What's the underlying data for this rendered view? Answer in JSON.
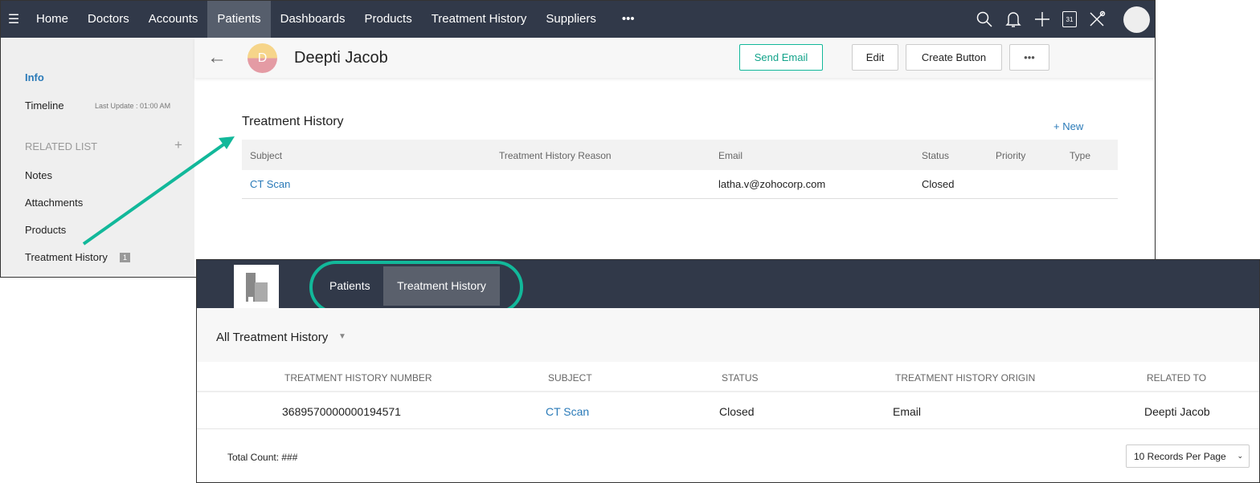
{
  "nav": {
    "items": [
      "Home",
      "Doctors",
      "Accounts",
      "Patients",
      "Dashboards",
      "Products",
      "Treatment History",
      "Suppliers"
    ],
    "active": "Patients",
    "more": "•••",
    "calendar_day": "31"
  },
  "sidebar": {
    "info": "Info",
    "timeline": "Timeline",
    "last_update": "Last Update : 01:00 AM",
    "related_list": "RELATED LIST",
    "add": "+",
    "items": [
      "Notes",
      "Attachments",
      "Products",
      "Treatment History"
    ],
    "treatment_count": "1"
  },
  "record": {
    "avatar_letter": "D",
    "name": "Deepti Jacob",
    "send_email": "Send Email",
    "edit": "Edit",
    "create_button": "Create Button",
    "more": "•••"
  },
  "related": {
    "title": "Treatment History",
    "new": "+ New",
    "headers": [
      "Subject",
      "Treatment History Reason",
      "Email",
      "Status",
      "Priority",
      "Type"
    ],
    "row": {
      "subject": "CT Scan",
      "reason": "",
      "email": "latha.v@zohocorp.com",
      "status": "Closed",
      "priority": "",
      "type": ""
    }
  },
  "portal": {
    "tabs": [
      "Patients",
      "Treatment History"
    ],
    "view": "All Treatment History",
    "headers": [
      "TREATMENT HISTORY NUMBER",
      "SUBJECT",
      "STATUS",
      "TREATMENT HISTORY ORIGIN",
      "RELATED TO"
    ],
    "row": {
      "number": "3689570000000194571",
      "subject": "CT Scan",
      "status": "Closed",
      "origin": "Email",
      "related_to": "Deepti Jacob"
    },
    "total": "Total Count: ###",
    "per_page": "10 Records Per Page"
  },
  "colors": {
    "accent": "#12b89a",
    "nav": "#313949",
    "link": "#2a7ab8"
  }
}
